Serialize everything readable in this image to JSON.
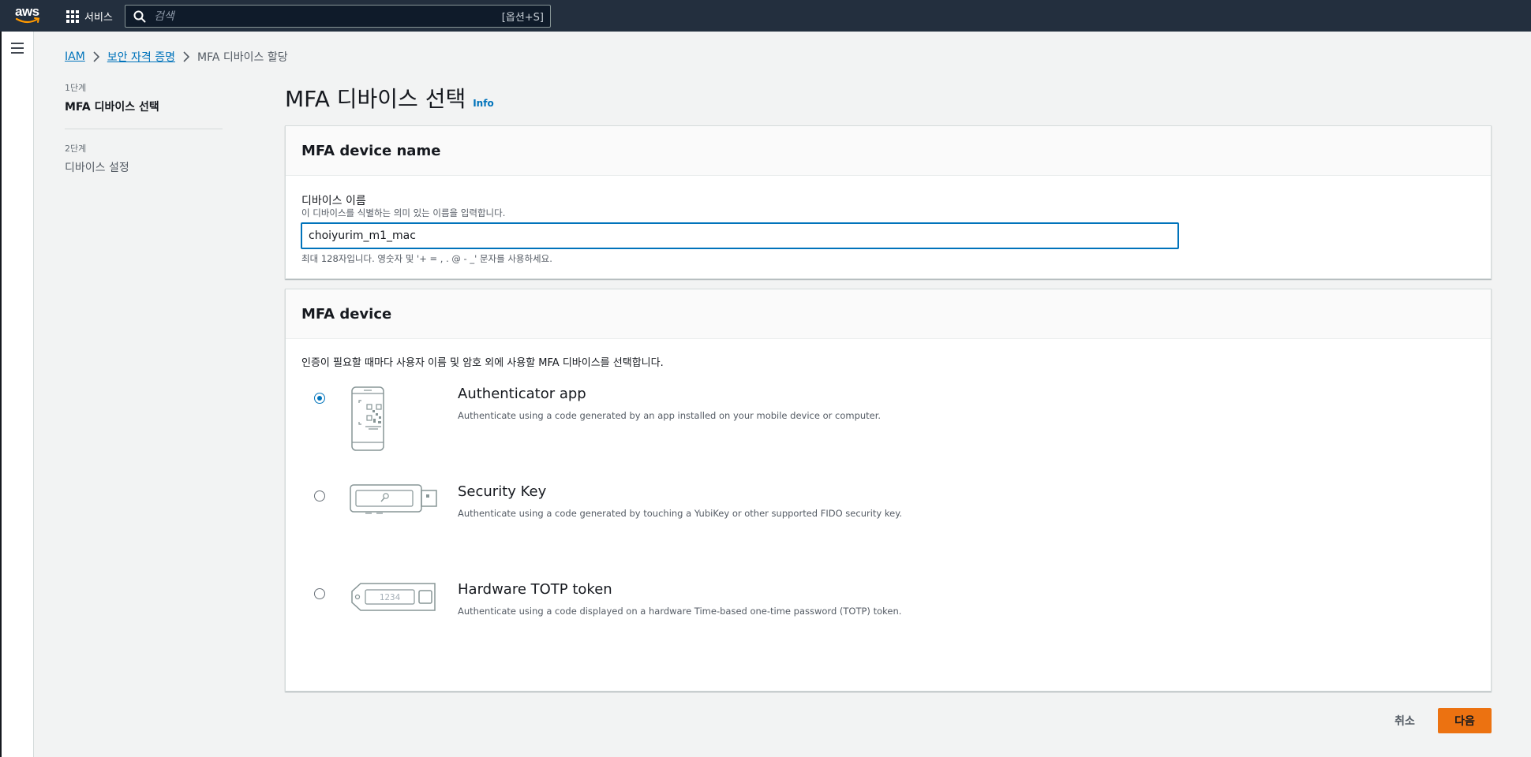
{
  "topnav": {
    "logo_text": "aws",
    "services_label": "서비스",
    "search_placeholder": "검색",
    "search_shortcut": "[옵션+S]"
  },
  "breadcrumb": {
    "items": [
      "IAM",
      "보안 자격 증명"
    ],
    "current": "MFA 디바이스 할당"
  },
  "steps": [
    {
      "label": "1단계",
      "title": "MFA 디바이스 선택"
    },
    {
      "label": "2단계",
      "title": "디바이스 설정"
    }
  ],
  "page": {
    "title": "MFA 디바이스 선택",
    "info": "Info"
  },
  "name_section": {
    "header": "MFA device name",
    "field_label": "디바이스 이름",
    "field_desc": "이 디바이스를 식별하는 의미 있는 이름을 입력합니다.",
    "value": "choiyurim_m1_mac",
    "constraint": "최대 128자입니다. 영숫자 및 '+ = , . @ - _' 문자를 사용하세요."
  },
  "device_section": {
    "header": "MFA device",
    "description": "인증이 필요할 때마다 사용자 이름 및 암호 외에 사용할 MFA 디바이스를 선택합니다.",
    "options": [
      {
        "title": "Authenticator app",
        "desc": "Authenticate using a code generated by an app installed on your mobile device or computer.",
        "selected": true,
        "icon": "phone-qr-icon"
      },
      {
        "title": "Security Key",
        "desc": "Authenticate using a code generated by touching a YubiKey or other supported FIDO security key.",
        "selected": false,
        "icon": "usb-key-icon"
      },
      {
        "title": "Hardware TOTP token",
        "desc": "Authenticate using a code displayed on a hardware Time-based one-time password (TOTP) token.",
        "selected": false,
        "icon": "totp-token-icon",
        "token_display": "1234"
      }
    ]
  },
  "footer": {
    "cancel_label": "취소",
    "next_label": "다음"
  },
  "colors": {
    "nav_bg": "#232f3e",
    "link": "#0073bb",
    "primary_button": "#ec7211"
  }
}
